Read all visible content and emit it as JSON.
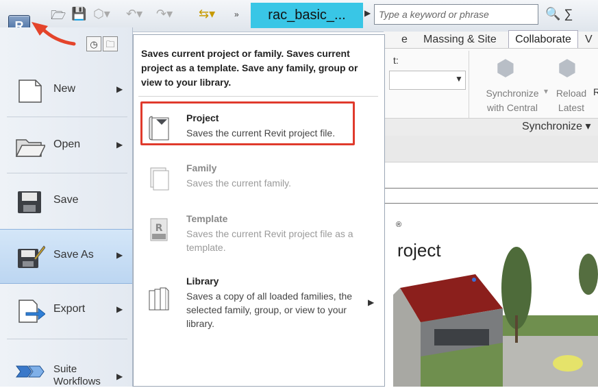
{
  "title_bar": {
    "file_name": "rac_basic_...",
    "search_placeholder": "Type a keyword or phrase"
  },
  "ribbon": {
    "tabs": [
      "e",
      "Massing & Site",
      "Collaborate",
      "V"
    ],
    "active_tab": "Collaborate",
    "label_fragment": "t:",
    "buttons": [
      {
        "line1": "Synchronize",
        "line2": "with Central"
      },
      {
        "line1": "Reload",
        "line2": "Latest"
      }
    ],
    "reload_trailing": "R",
    "panel_label": "Synchronize ▾"
  },
  "canvas": {
    "heading_fragment": "roject",
    "registered_mark": "®"
  },
  "app_menu": {
    "items": [
      {
        "label": "New",
        "has_submenu": true
      },
      {
        "label": "Open",
        "has_submenu": true
      },
      {
        "label": "Save",
        "has_submenu": false
      },
      {
        "label": "Save As",
        "has_submenu": true,
        "active": true
      },
      {
        "label": "Export",
        "has_submenu": true
      },
      {
        "label": "Suite\nWorkflows",
        "has_submenu": true
      }
    ]
  },
  "submenu": {
    "description": "Saves current project or family. Saves current project as a template. Save any family, group or view to your library.",
    "items": [
      {
        "title": "Project",
        "desc": "Saves the current Revit project file.",
        "enabled": true,
        "highlighted": true
      },
      {
        "title": "Family",
        "desc": "Saves the current family.",
        "enabled": false
      },
      {
        "title": "Template",
        "desc": "Saves the current Revit project file as a template.",
        "enabled": false
      },
      {
        "title": "Library",
        "desc": "Saves a copy of all loaded families, the selected family, group, or view to your library.",
        "enabled": true
      }
    ]
  },
  "colors": {
    "title_bg": "#39c6e6",
    "highlight": "#e03a2c",
    "active_item": "#bcd6f1"
  }
}
